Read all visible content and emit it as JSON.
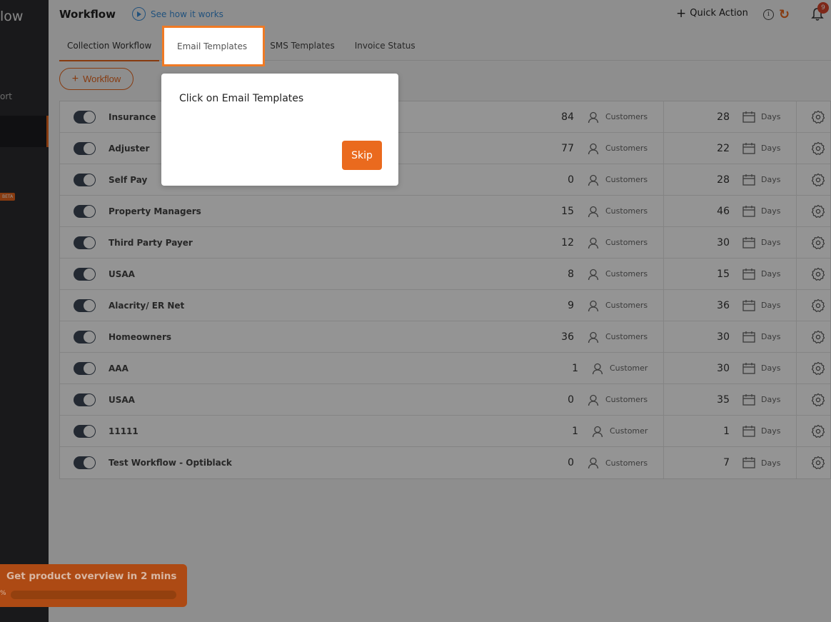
{
  "sidebar": {
    "brand_fragment": "low",
    "report_fragment": "ort",
    "beta_label": "BETA"
  },
  "header": {
    "title": "Workflow",
    "how_link": "See how it works",
    "quick_action": "Quick Action",
    "info_glyph": "i",
    "notification_count": "9"
  },
  "tabs": [
    {
      "label": "Collection Workflow",
      "active": true
    },
    {
      "label": "Email Templates",
      "active": false,
      "highlighted": true
    },
    {
      "label": "SMS Templates",
      "active": false
    },
    {
      "label": "Invoice Status",
      "active": false
    }
  ],
  "add_workflow_label": "Workflow",
  "workflows": [
    {
      "name": "Insurance",
      "enabled": true,
      "customers": "84",
      "customer_label": "Customers",
      "days": "28",
      "days_label": "Days"
    },
    {
      "name": "Adjuster",
      "enabled": true,
      "customers": "77",
      "customer_label": "Customers",
      "days": "22",
      "days_label": "Days"
    },
    {
      "name": "Self Pay",
      "enabled": true,
      "customers": "0",
      "customer_label": "Customers",
      "days": "28",
      "days_label": "Days"
    },
    {
      "name": "Property Managers",
      "enabled": true,
      "customers": "15",
      "customer_label": "Customers",
      "days": "46",
      "days_label": "Days"
    },
    {
      "name": "Third Party Payer",
      "enabled": true,
      "customers": "12",
      "customer_label": "Customers",
      "days": "30",
      "days_label": "Days"
    },
    {
      "name": "USAA",
      "enabled": true,
      "customers": "8",
      "customer_label": "Customers",
      "days": "15",
      "days_label": "Days"
    },
    {
      "name": "Alacrity/ ER Net",
      "enabled": true,
      "customers": "9",
      "customer_label": "Customers",
      "days": "36",
      "days_label": "Days"
    },
    {
      "name": "Homeowners",
      "enabled": true,
      "customers": "36",
      "customer_label": "Customers",
      "days": "30",
      "days_label": "Days"
    },
    {
      "name": "AAA",
      "enabled": true,
      "customers": "1",
      "customer_label": "Customer",
      "days": "30",
      "days_label": "Days"
    },
    {
      "name": "USAA",
      "enabled": true,
      "customers": "0",
      "customer_label": "Customers",
      "days": "35",
      "days_label": "Days"
    },
    {
      "name": "11111",
      "enabled": true,
      "customers": "1",
      "customer_label": "Customer",
      "days": "1",
      "days_label": "Days"
    },
    {
      "name": "Test Workflow - Optiblack",
      "enabled": true,
      "customers": "0",
      "customer_label": "Customers",
      "days": "7",
      "days_label": "Days"
    }
  ],
  "tour": {
    "message": "Click on Email Templates",
    "skip_label": "Skip"
  },
  "onboarding": {
    "title": "Get product overview in 2 mins",
    "percent_label": "%",
    "progress": 0
  },
  "colors": {
    "accent": "#e8671d",
    "link": "#3b8ed8",
    "toggle_on": "#3d4856",
    "badge": "#d9452b"
  }
}
